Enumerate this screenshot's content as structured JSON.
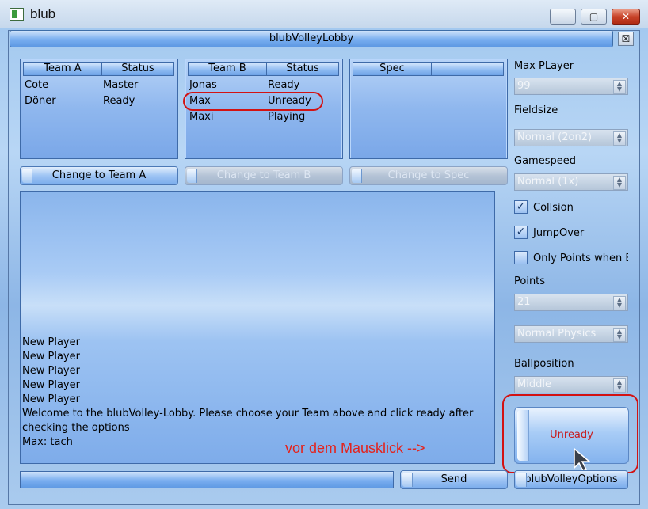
{
  "window": {
    "title": "blub",
    "min": "–",
    "max": "▢",
    "close": "✕"
  },
  "lobby": {
    "title": "blubVolleyLobby",
    "close": "☒"
  },
  "team_a": {
    "headers": [
      "Team A",
      "Status"
    ],
    "rows": [
      {
        "name": "Cote",
        "status": "Master"
      },
      {
        "name": "Döner",
        "status": "Ready"
      }
    ]
  },
  "team_b": {
    "headers": [
      "Team B",
      "Status"
    ],
    "rows": [
      {
        "name": "Jonas",
        "status": "Ready"
      },
      {
        "name": "Max",
        "status": "Unready"
      },
      {
        "name": "Maxi",
        "status": "Playing"
      }
    ]
  },
  "spec": {
    "headers": [
      "Spec",
      ""
    ]
  },
  "buttons": {
    "change_a": "Change to Team A",
    "change_b": "Change to Team B",
    "change_spec": "Change to Spec",
    "send": "Send",
    "options": "blubVolleyOptions",
    "ready_toggle": "Unready"
  },
  "chat": {
    "lines": [
      "New Player",
      "New Player",
      "New Player",
      "New Player",
      "New Player",
      "Welcome to the blubVolley-Lobby. Please choose your Team above and click ready after",
      "checking the options",
      "Max: tach"
    ]
  },
  "options": {
    "max_player_label": "Max PLayer",
    "max_player_value": "99",
    "fieldsize_label": "Fieldsize",
    "fieldsize_value": "Normal (2on2)",
    "gamespeed_label": "Gamespeed",
    "gamespeed_value": "Normal (1x)",
    "collision_label": "Collsion",
    "jumpover_label": "JumpOver",
    "onlypoints_label": "Only Points when Bo",
    "points_label": "Points",
    "points_value": "21",
    "physics_value": "Normal Physics",
    "ballposition_label": "Ballposition",
    "ballposition_value": "Middle",
    "collision_checked": true,
    "jumpover_checked": true,
    "onlypoints_checked": false
  },
  "annotation": "vor dem Mausklick -->",
  "colors": {
    "highlight_red": "#d31212"
  }
}
